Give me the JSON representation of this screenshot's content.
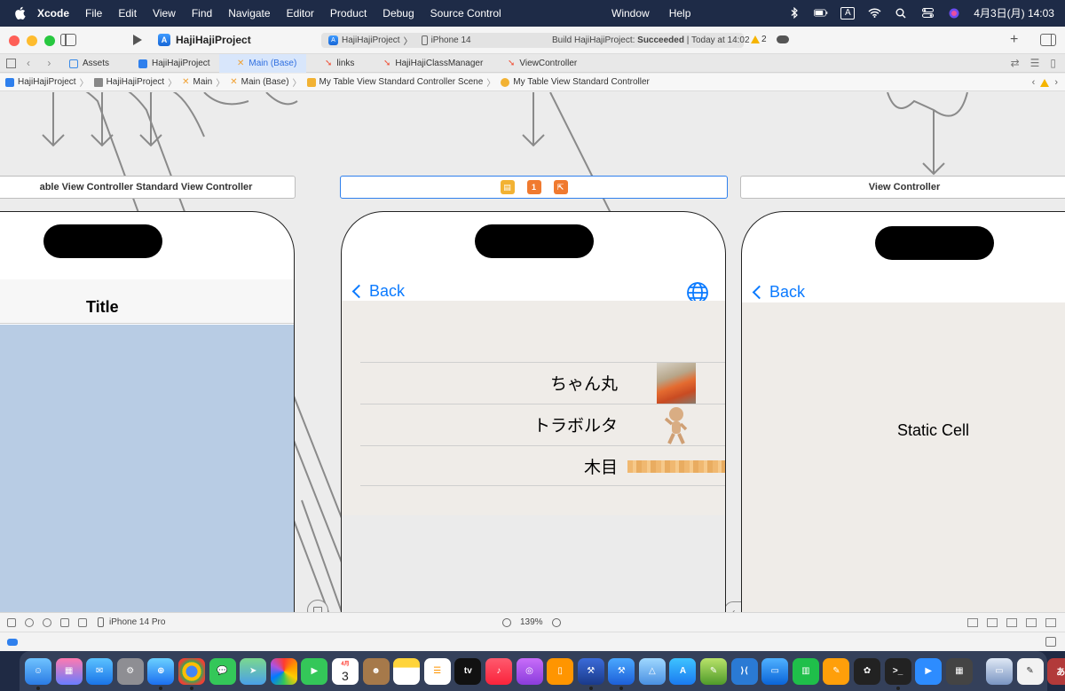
{
  "menubar": {
    "app_name": "Xcode",
    "menus": [
      "File",
      "Edit",
      "View",
      "Find",
      "Navigate",
      "Editor",
      "Product",
      "Debug",
      "Source Control"
    ],
    "center_menus": [
      "Window",
      "Help"
    ],
    "input_source": "A",
    "datetime": "4月3日(月)  14:03"
  },
  "toolbar": {
    "project_name": "HajiHajiProject",
    "scheme_project": "HajiHajiProject",
    "scheme_device": "iPhone 14",
    "build_status_prefix": "Build HajiHajiProject: ",
    "build_status_result": "Succeeded",
    "build_status_time": " | Today at 14:02",
    "warning_count": "2"
  },
  "tabs": [
    {
      "label": "Assets",
      "icon": "assets-icon"
    },
    {
      "label": "HajiHajiProject",
      "icon": "app-icon"
    },
    {
      "label": "Main (Base)",
      "icon": "storyboard-icon",
      "active": true
    },
    {
      "label": "links",
      "icon": "swift-icon"
    },
    {
      "label": "HajiHajiClassManager",
      "icon": "swift-icon"
    },
    {
      "label": "ViewController",
      "icon": "swift-icon"
    }
  ],
  "jumpbar": {
    "items": [
      "HajiHajiProject",
      "HajiHajiProject",
      "Main",
      "Main (Base)",
      "My Table View Standard Controller Scene",
      "My Table View Standard Controller"
    ]
  },
  "canvas": {
    "scene_left_title": "able View Controller Standard View Controller",
    "scene_right_title": "View Controller",
    "left_phone": {
      "nav_title": "Title"
    },
    "middle_phone": {
      "back_label": "Back",
      "rows": [
        {
          "label": "ちゃん丸",
          "thumb": "dog-photo"
        },
        {
          "label": "トラボルタ",
          "thumb": "figure-photo"
        },
        {
          "label": "木目",
          "thumb": "wood-texture"
        }
      ]
    },
    "right_phone": {
      "back_label": "Back",
      "cell_text": "Static Cell"
    }
  },
  "bottombar": {
    "device": "iPhone 14 Pro",
    "zoom": "139%"
  },
  "colors": {
    "accent": "#0a7aff",
    "selection": "#2f80ed",
    "left_table_bg": "#b8cce4",
    "menubar_bg": "#1e2b47"
  },
  "dock": {
    "calendar_day": "3",
    "calendar_month": "4月",
    "tv_label": "tv"
  }
}
